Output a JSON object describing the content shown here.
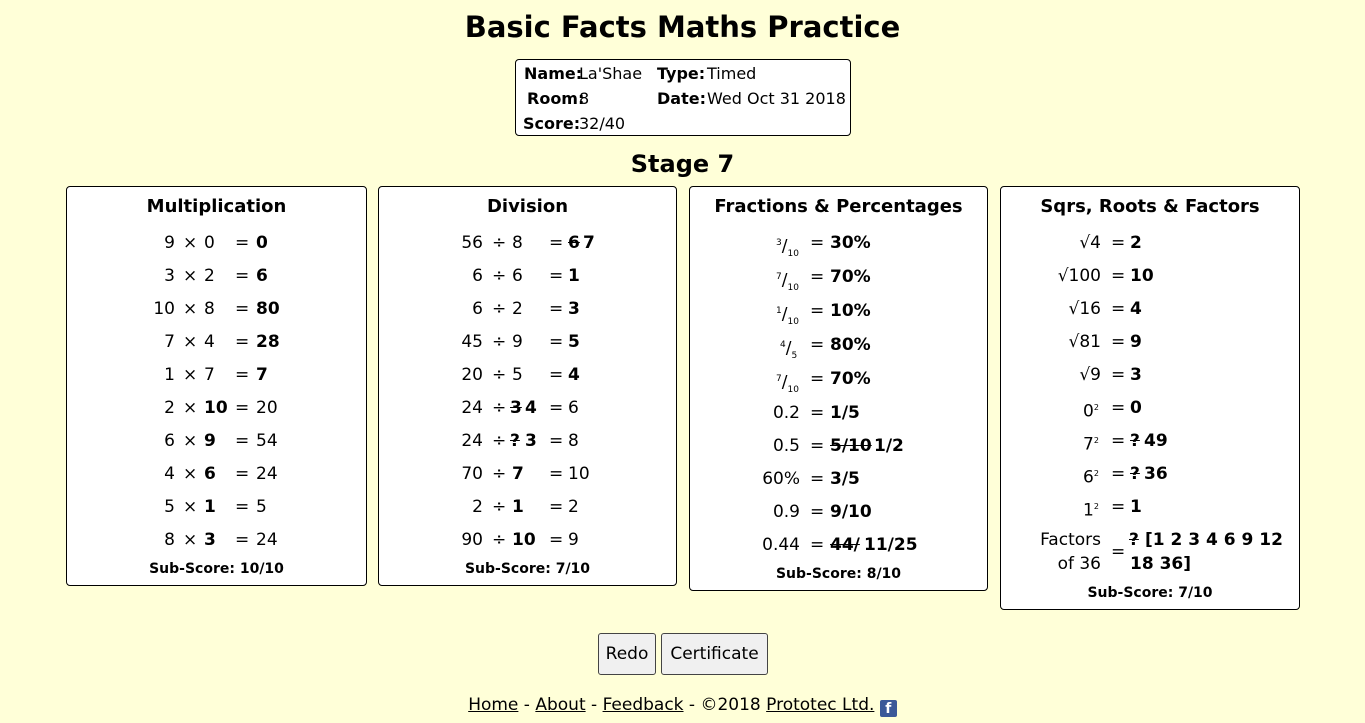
{
  "title": "Basic Facts Maths Practice",
  "info": {
    "name_label": "Name:",
    "name": "La'Shae",
    "type_label": "Type:",
    "type": "Timed",
    "room_label": "Room:",
    "room": "8",
    "date_label": "Date:",
    "date": "Wed Oct 31 2018",
    "score_label": "Score:",
    "score": "32/40"
  },
  "stage": "Stage 7",
  "multiplication": {
    "title": "Multiplication",
    "rows": [
      {
        "a": "9",
        "op": "×",
        "b": "0",
        "eq": "=",
        "ans": "0"
      },
      {
        "a": "3",
        "op": "×",
        "b": "2",
        "eq": "=",
        "ans": "6"
      },
      {
        "a": "10",
        "op": "×",
        "b": "8",
        "eq": "=",
        "ans": "80"
      },
      {
        "a": "7",
        "op": "×",
        "b": "4",
        "eq": "=",
        "ans": "28"
      },
      {
        "a": "1",
        "op": "×",
        "b": "7",
        "eq": "=",
        "ans": "7"
      },
      {
        "a": "2",
        "op": "×",
        "b": "10",
        "eq": "=",
        "ans": "20"
      },
      {
        "a": "6",
        "op": "×",
        "b": "9",
        "eq": "=",
        "ans": "54"
      },
      {
        "a": "4",
        "op": "×",
        "b": "6",
        "eq": "=",
        "ans": "24"
      },
      {
        "a": "5",
        "op": "×",
        "b": "1",
        "eq": "=",
        "ans": "5"
      },
      {
        "a": "8",
        "op": "×",
        "b": "3",
        "eq": "=",
        "ans": "24"
      }
    ],
    "subscore": "Sub-Score: 10/10"
  },
  "division": {
    "title": "Division",
    "rows": [
      {
        "a": "56",
        "op": "÷",
        "b": "8",
        "eq": "=",
        "ans_wrong": "6",
        "ans": "7"
      },
      {
        "a": "6",
        "op": "÷",
        "b": "6",
        "eq": "=",
        "ans": "1"
      },
      {
        "a": "6",
        "op": "÷",
        "b": "2",
        "eq": "=",
        "ans": "3"
      },
      {
        "a": "45",
        "op": "÷",
        "b": "9",
        "eq": "=",
        "ans": "5"
      },
      {
        "a": "20",
        "op": "÷",
        "b": "5",
        "eq": "=",
        "ans": "4"
      },
      {
        "a": "24",
        "op": "÷",
        "b_wrong": "3",
        "b": "4",
        "eq": "=",
        "c": "6"
      },
      {
        "a": "24",
        "op": "÷",
        "b_wrong": "?",
        "b": "3",
        "eq": "=",
        "c": "8"
      },
      {
        "a": "70",
        "op": "÷",
        "b": "7",
        "eq": "=",
        "c": "10"
      },
      {
        "a": "2",
        "op": "÷",
        "b": "1",
        "eq": "=",
        "c": "2"
      },
      {
        "a": "90",
        "op": "÷",
        "b": "10",
        "eq": "=",
        "c": "9"
      }
    ],
    "subscore": "Sub-Score: 7/10"
  },
  "fractions": {
    "title": "Fractions & Percentages",
    "rows": [
      {
        "num": "3",
        "den": "10",
        "eq": "=",
        "ans": "30%"
      },
      {
        "num": "7",
        "den": "10",
        "eq": "=",
        "ans": "70%"
      },
      {
        "num": "1",
        "den": "10",
        "eq": "=",
        "ans": "10%"
      },
      {
        "num": "4",
        "den": "5",
        "eq": "=",
        "ans": "80%"
      },
      {
        "num": "7",
        "den": "10",
        "eq": "=",
        "ans": "70%"
      },
      {
        "q": "0.2",
        "eq": "=",
        "ans": "1/5"
      },
      {
        "q": "0.5",
        "eq": "=",
        "ans_wrong": "5/10",
        "ans": "1/2"
      },
      {
        "q": "60%",
        "eq": "=",
        "ans": "3/5"
      },
      {
        "q": "0.9",
        "eq": "=",
        "ans": "9/10"
      },
      {
        "q": "0.44",
        "eq": "=",
        "ans_wrong": "44/",
        "ans": "11/25"
      }
    ],
    "subscore": "Sub-Score: 8/10"
  },
  "squares": {
    "title": "Sqrs, Roots & Factors",
    "rows": [
      {
        "q": "√4",
        "eq": "=",
        "ans": "2"
      },
      {
        "q": "√100",
        "eq": "=",
        "ans": "10"
      },
      {
        "q": "√16",
        "eq": "=",
        "ans": "4"
      },
      {
        "q": "√81",
        "eq": "=",
        "ans": "9"
      },
      {
        "q": "√9",
        "eq": "=",
        "ans": "3"
      },
      {
        "base": "0",
        "exp": "2",
        "eq": "=",
        "ans": "0"
      },
      {
        "base": "7",
        "exp": "2",
        "eq": "=",
        "ans_wrong": "?",
        "ans": "49"
      },
      {
        "base": "6",
        "exp": "2",
        "eq": "=",
        "ans_wrong": "?",
        "ans": "36"
      },
      {
        "base": "1",
        "exp": "2",
        "eq": "=",
        "ans": "1"
      }
    ],
    "factors_line1": "Factors",
    "factors_line2": "of 36",
    "factors_eq": "=",
    "factors_wrong": "?",
    "factors_ans_line1": "[1 2 3 4 6 9 12",
    "factors_ans_line2": "18 36]",
    "subscore": "Sub-Score: 7/10"
  },
  "buttons": {
    "redo": "Redo",
    "certificate": "Certificate"
  },
  "footer": {
    "home": "Home",
    "sep1": " - ",
    "about": "About",
    "sep2": " - ",
    "feedback": "Feedback",
    "sep3": " - ©2018 ",
    "company": "Prototec Ltd.",
    "fb_glyph": "f"
  }
}
